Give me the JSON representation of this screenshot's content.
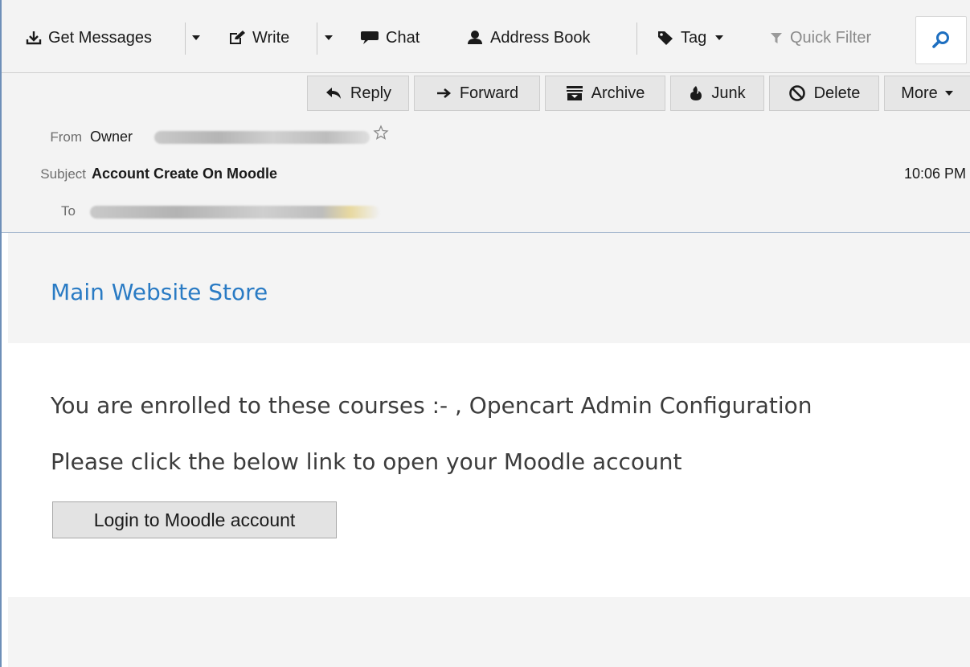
{
  "toolbar": {
    "get_messages": "Get Messages",
    "write": "Write",
    "chat": "Chat",
    "address_book": "Address Book",
    "tag": "Tag",
    "quick_filter": "Quick Filter"
  },
  "header": {
    "buttons": {
      "reply": "Reply",
      "forward": "Forward",
      "archive": "Archive",
      "junk": "Junk",
      "delete": "Delete",
      "more": "More"
    },
    "from_label": "From",
    "from_value": "Owner",
    "subject_label": "Subject",
    "subject_value": "Account Create On Moodle",
    "time": "10:06 PM",
    "to_label": "To"
  },
  "message": {
    "store_link": "Main Website Store",
    "line1": "You are enrolled to these courses :- , Opencart Admin Configuration",
    "line2": "Please click the below link to open your Moodle account",
    "login_button": "Login to Moodle account"
  },
  "colors": {
    "link": "#2a7bc4",
    "search_icon": "#1e6fc0",
    "toolbar_bg": "#f3f3f3"
  }
}
